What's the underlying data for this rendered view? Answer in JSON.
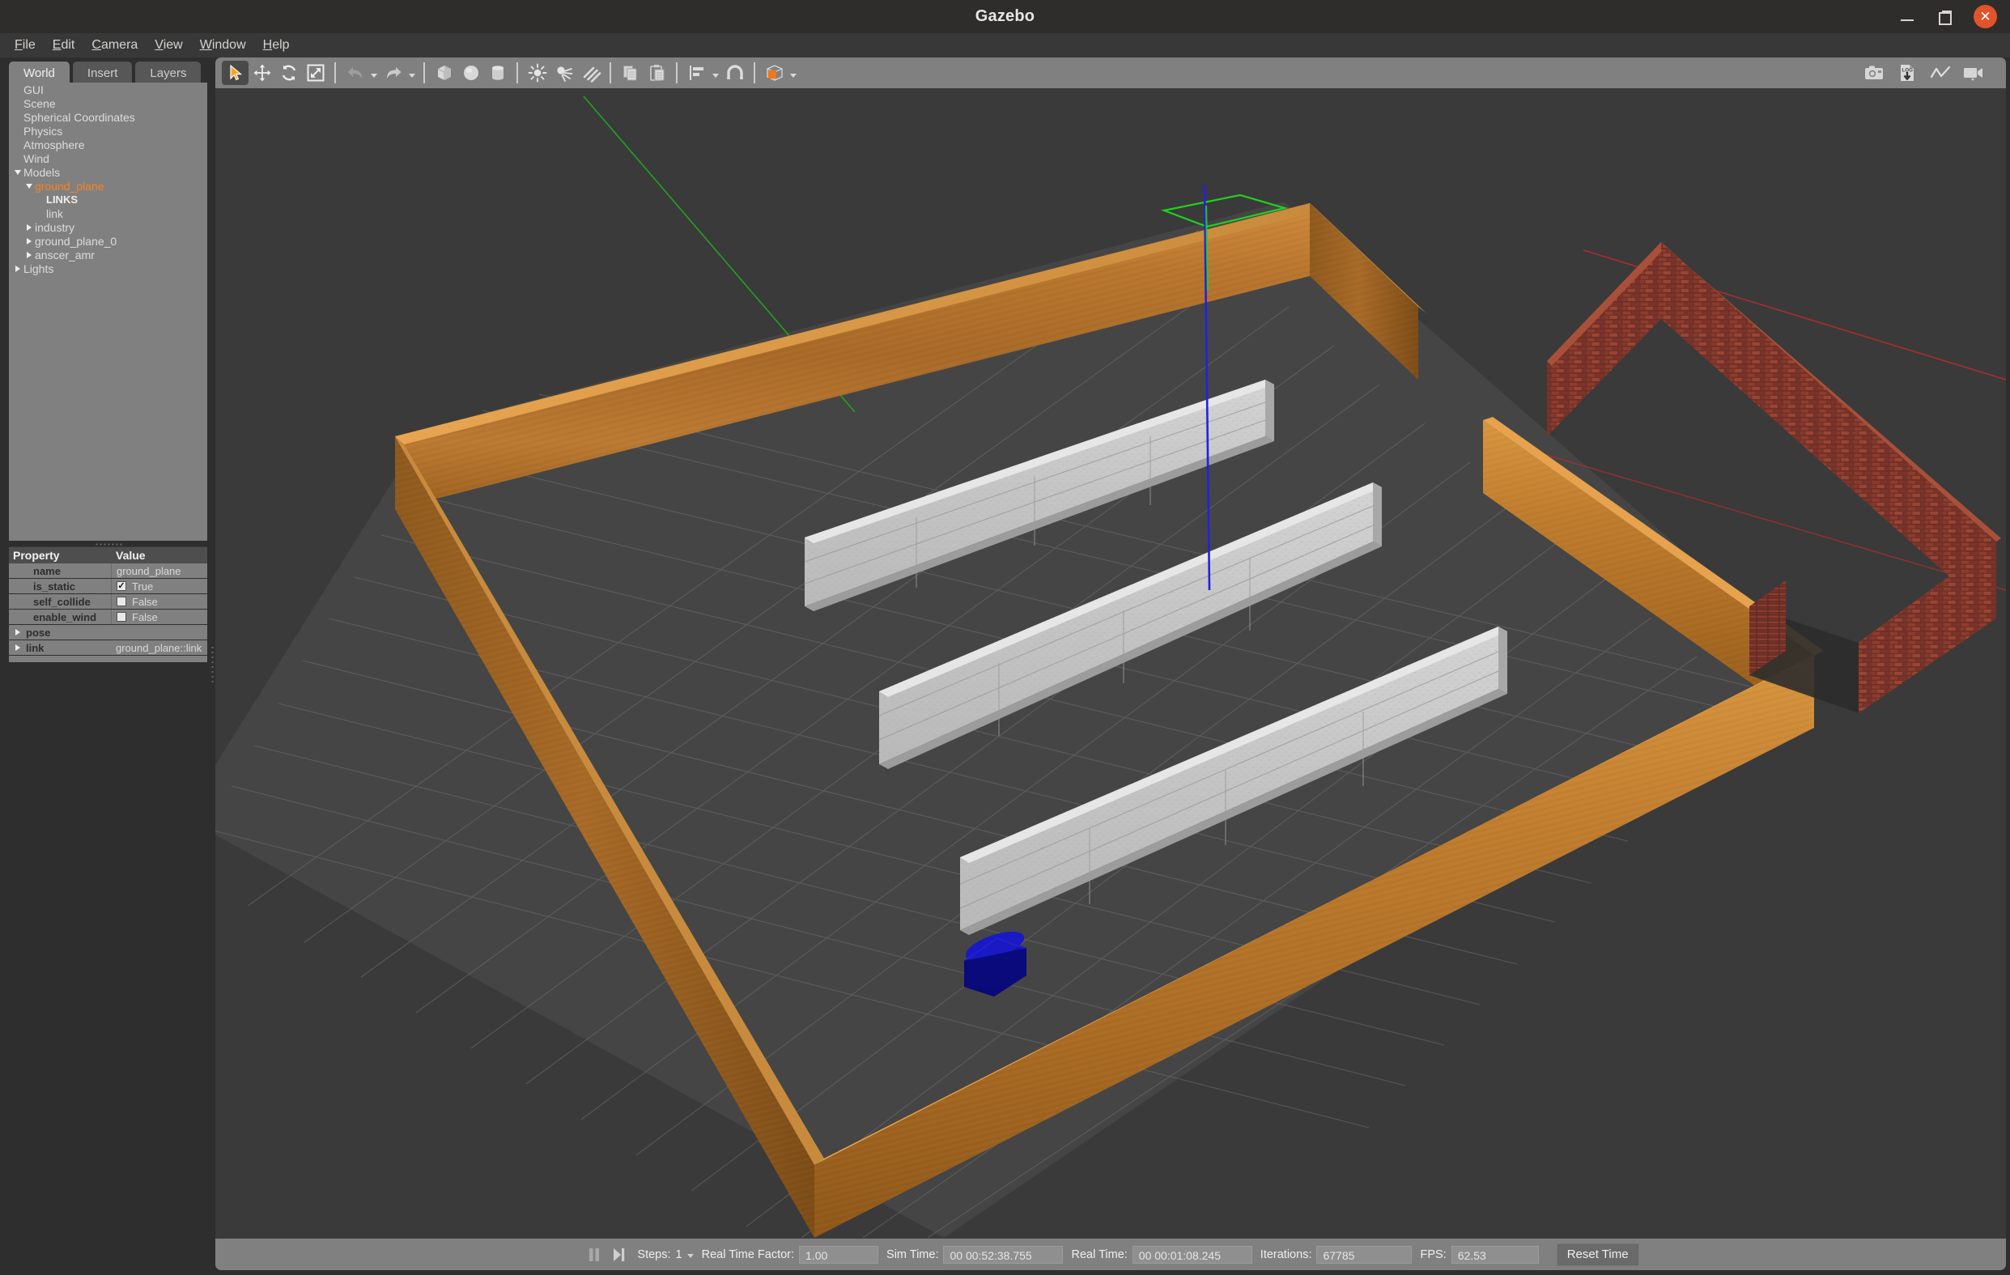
{
  "window": {
    "title": "Gazebo",
    "controls": {
      "minimize": "minimize-icon",
      "maximize": "maximize-icon",
      "close": "close-icon"
    }
  },
  "menubar": {
    "items": [
      {
        "label": "File",
        "mnemonic": "F"
      },
      {
        "label": "Edit",
        "mnemonic": "E"
      },
      {
        "label": "Camera",
        "mnemonic": "C"
      },
      {
        "label": "View",
        "mnemonic": "V"
      },
      {
        "label": "Window",
        "mnemonic": "W"
      },
      {
        "label": "Help",
        "mnemonic": "H"
      }
    ]
  },
  "left_panel": {
    "tabs": [
      {
        "label": "World",
        "active": true
      },
      {
        "label": "Insert",
        "active": false
      },
      {
        "label": "Layers",
        "active": false
      }
    ],
    "tree": [
      {
        "label": "GUI",
        "indent": 1,
        "twisty": "none",
        "style": "normal"
      },
      {
        "label": "Scene",
        "indent": 1,
        "twisty": "none",
        "style": "normal"
      },
      {
        "label": "Spherical Coordinates",
        "indent": 1,
        "twisty": "none",
        "style": "normal"
      },
      {
        "label": "Physics",
        "indent": 1,
        "twisty": "none",
        "style": "normal"
      },
      {
        "label": "Atmosphere",
        "indent": 1,
        "twisty": "none",
        "style": "normal"
      },
      {
        "label": "Wind",
        "indent": 1,
        "twisty": "none",
        "style": "normal"
      },
      {
        "label": "Models",
        "indent": 1,
        "twisty": "down",
        "style": "normal"
      },
      {
        "label": "ground_plane",
        "indent": 2,
        "twisty": "down",
        "style": "selected"
      },
      {
        "label": "LINKS",
        "indent": 3,
        "twisty": "none",
        "style": "header"
      },
      {
        "label": "link",
        "indent": 3,
        "twisty": "none",
        "style": "normal"
      },
      {
        "label": "industry",
        "indent": 2,
        "twisty": "right",
        "style": "normal"
      },
      {
        "label": "ground_plane_0",
        "indent": 2,
        "twisty": "right",
        "style": "normal"
      },
      {
        "label": "anscer_amr",
        "indent": 2,
        "twisty": "right",
        "style": "normal"
      },
      {
        "label": "Lights",
        "indent": 1,
        "twisty": "right",
        "style": "normal"
      }
    ],
    "property_table": {
      "headers": {
        "property": "Property",
        "value": "Value"
      },
      "rows": [
        {
          "key": "name",
          "value": "ground_plane",
          "type": "text",
          "twisty": false
        },
        {
          "key": "is_static",
          "value": "True",
          "type": "checkbox",
          "checked": true,
          "twisty": false
        },
        {
          "key": "self_collide",
          "value": "False",
          "type": "checkbox",
          "checked": false,
          "twisty": false
        },
        {
          "key": "enable_wind",
          "value": "False",
          "type": "checkbox",
          "checked": false,
          "twisty": false
        },
        {
          "key": "pose",
          "value": "",
          "type": "text",
          "twisty": true
        },
        {
          "key": "link",
          "value": "ground_plane::link",
          "type": "text",
          "twisty": true
        }
      ]
    }
  },
  "toolbar": {
    "left_tools": [
      {
        "name": "select-mode-button",
        "icon": "cursor-arrow-icon",
        "active": true
      },
      {
        "name": "translate-mode-button",
        "icon": "move-arrows-icon",
        "active": false
      },
      {
        "name": "rotate-mode-button",
        "icon": "rotate-icon",
        "active": false
      },
      {
        "name": "scale-mode-button",
        "icon": "scale-icon",
        "active": false
      },
      {
        "name": "undo-button",
        "icon": "undo-arrow-icon",
        "active": false
      },
      {
        "name": "redo-button",
        "icon": "redo-arrow-icon",
        "active": false
      },
      {
        "name": "insert-box-button",
        "icon": "box-icon",
        "active": false
      },
      {
        "name": "insert-sphere-button",
        "icon": "sphere-icon",
        "active": false
      },
      {
        "name": "insert-cylinder-button",
        "icon": "cylinder-icon",
        "active": false
      },
      {
        "name": "point-light-button",
        "icon": "point-light-icon",
        "active": false
      },
      {
        "name": "spot-light-button",
        "icon": "spot-light-icon",
        "active": false
      },
      {
        "name": "directional-light-button",
        "icon": "directional-light-icon",
        "active": false
      },
      {
        "name": "copy-button",
        "icon": "copy-icon",
        "active": false
      },
      {
        "name": "paste-button",
        "icon": "paste-icon",
        "active": false
      },
      {
        "name": "align-button",
        "icon": "align-icon",
        "active": false
      },
      {
        "name": "snap-button",
        "icon": "magnet-icon",
        "active": false
      },
      {
        "name": "view-mode-button",
        "icon": "wireframe-box-icon",
        "active": false
      }
    ],
    "right_tools": [
      {
        "name": "screenshot-button",
        "icon": "camera-icon"
      },
      {
        "name": "log-record-button",
        "icon": "log-download-icon",
        "label": "LOG"
      },
      {
        "name": "plot-button",
        "icon": "line-chart-icon"
      },
      {
        "name": "video-record-button",
        "icon": "video-camera-icon"
      }
    ]
  },
  "statusbar": {
    "pause_button": "pause-icon",
    "step_button": "step-forward-icon",
    "steps_label": "Steps:",
    "steps_value": "1",
    "real_time_factor_label": "Real Time Factor:",
    "real_time_factor_value": "1.00",
    "sim_time_label": "Sim Time:",
    "sim_time_value": "00 00:52:38.755",
    "real_time_label": "Real Time:",
    "real_time_value": "00 00:01:08.245",
    "iterations_label": "Iterations:",
    "iterations_value": "67785",
    "fps_label": "FPS:",
    "fps_value": "62.53",
    "reset_button_label": "Reset Time"
  },
  "scene": {
    "description": "3D warehouse simulation viewport",
    "background_color": "#3a3a3a",
    "ground_color": "#454545",
    "grid_color": "#6d6d6d",
    "wood_wall_color": "#b06d28",
    "brick_wall_color": "#7e3a31",
    "shelf_color": "#c8c8c8",
    "robot_color": "#0b0b9c",
    "selection_box_color": "#22c022",
    "z_axis_color": "#2222dd",
    "x_axis_color": "#cc2222",
    "y_axis_color": "#22bb22"
  }
}
